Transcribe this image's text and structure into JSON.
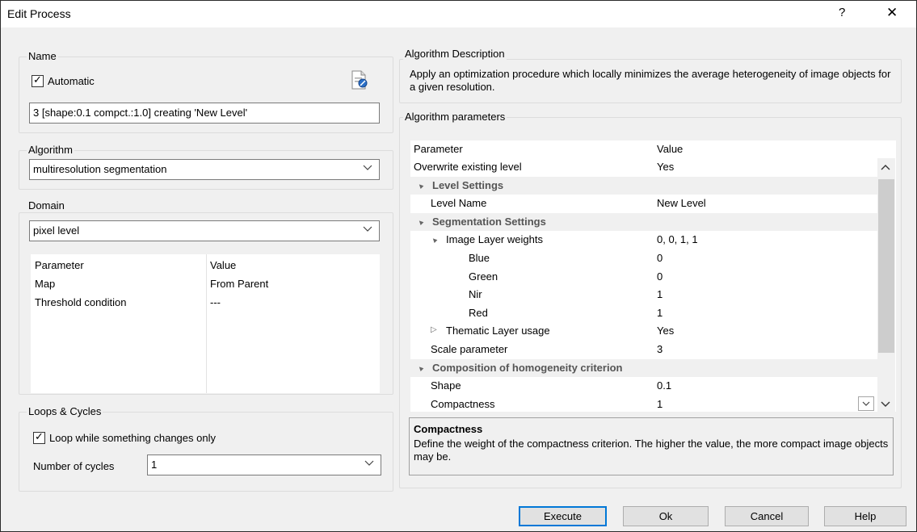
{
  "window": {
    "title": "Edit Process",
    "help_label": "?",
    "close_label": "✕"
  },
  "name_group": {
    "label": "Name",
    "automatic_checked": true,
    "automatic_label": "Automatic",
    "name_value": "3 [shape:0.1 compct.:1.0] creating 'New Level'",
    "edit_icon": "edit-document-icon"
  },
  "algorithm_group": {
    "label": "Algorithm",
    "selected": "multiresolution segmentation"
  },
  "domain_group": {
    "label": "Domain",
    "selected": "pixel level",
    "table": {
      "headers": [
        "Parameter",
        "Value"
      ],
      "rows": [
        {
          "param": "Map",
          "value": "From Parent"
        },
        {
          "param": "Threshold condition",
          "value": "---"
        }
      ]
    }
  },
  "loops_group": {
    "label": "Loops & Cycles",
    "loop_checked": true,
    "loop_label": "Loop while something changes only",
    "cycles_label": "Number of cycles",
    "cycles_value": "1"
  },
  "description_group": {
    "label": "Algorithm Description",
    "text": "Apply an optimization procedure which locally minimizes the average heterogeneity of image objects for a given resolution."
  },
  "params_group": {
    "label": "Algorithm parameters",
    "headers": [
      "Parameter",
      "Value"
    ],
    "rows": [
      {
        "name": "Overwrite existing level",
        "value": "Yes",
        "indent": 0,
        "type": "item"
      },
      {
        "name": "Level Settings",
        "value": "",
        "indent": 1,
        "type": "section",
        "expander": "▲"
      },
      {
        "name": "Level Name",
        "value": "New Level",
        "indent": 2,
        "type": "item"
      },
      {
        "name": "Segmentation Settings",
        "value": "",
        "indent": 1,
        "type": "section",
        "expander": "▲"
      },
      {
        "name": "Image Layer weights",
        "value": "0, 0, 1, 1",
        "indent": 2,
        "type": "item",
        "expander": "▲"
      },
      {
        "name": "Blue",
        "value": "0",
        "indent": 3,
        "type": "item"
      },
      {
        "name": "Green",
        "value": "0",
        "indent": 3,
        "type": "item"
      },
      {
        "name": "Nir",
        "value": "1",
        "indent": 3,
        "type": "item"
      },
      {
        "name": "Red",
        "value": "1",
        "indent": 3,
        "type": "item"
      },
      {
        "name": "Thematic Layer usage",
        "value": "Yes",
        "indent": 2,
        "type": "item",
        "expander": "▷"
      },
      {
        "name": "Scale parameter",
        "value": "3",
        "indent": 1,
        "type": "item"
      },
      {
        "name": "Composition of homogeneity criterion",
        "value": "",
        "indent": 1,
        "type": "section",
        "expander": "▲"
      },
      {
        "name": "Shape",
        "value": "0.1",
        "indent": 2,
        "type": "item"
      },
      {
        "name": "Compactness",
        "value": "1",
        "indent": 2,
        "type": "item",
        "has_dropdown": true
      }
    ],
    "help_title": "Compactness",
    "help_text": "Define the weight of the compactness criterion. The higher the value, the more compact image objects may be."
  },
  "buttons": {
    "execute": "Execute",
    "ok": "Ok",
    "cancel": "Cancel",
    "help": "Help"
  }
}
